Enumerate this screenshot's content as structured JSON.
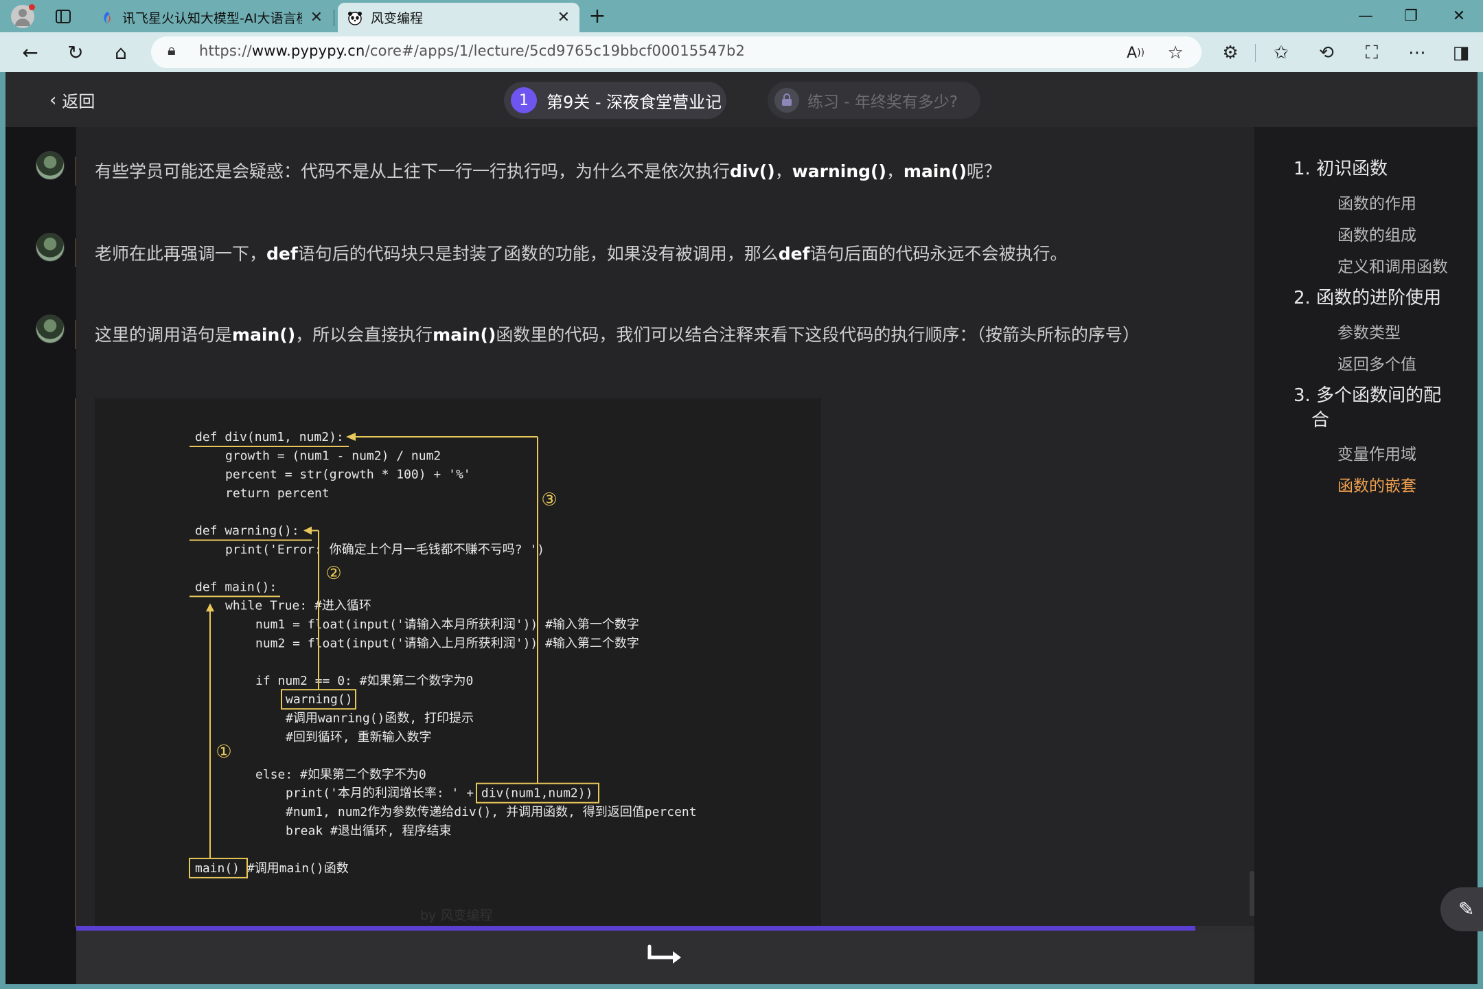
{
  "browser": {
    "tabs": [
      {
        "title": "讯飞星火认知大模型-AI大语言模",
        "active": false
      },
      {
        "title": "风变编程",
        "active": true
      }
    ],
    "url_prefix": "https://",
    "url_host": "www.pypypy.cn",
    "url_path": "/core#/apps/1/lecture/5cd9765c19bbcf00015547b2"
  },
  "header": {
    "back_label": "返回",
    "lesson_number": "1",
    "lesson_title": "第9关 - 深夜食堂营业记",
    "practice_title": "练习 - 年终奖有多少?"
  },
  "messages": [
    {
      "parts": [
        "有些学员可能还是会疑惑：代码不是从上往下一行一行执行吗，为什么不是依次执行",
        "div()",
        "，",
        "warning()",
        "，",
        "main()",
        "呢？"
      ]
    },
    {
      "parts": [
        "老师在此再强调一下，",
        "def",
        "语句后的代码块只是封装了函数的功能，如果没有被调用，那么",
        "def",
        "语句后面的代码永远不会被执行。"
      ]
    },
    {
      "parts": [
        "这里的调用语句是",
        "main()",
        "，所以会直接执行",
        "main()",
        "函数里的代码，我们可以结合注释来看下这段代码的执行顺序：（按箭头所标的序号）"
      ]
    }
  ],
  "code_image": {
    "lines": [
      "def div(num1, num2):",
      "    growth = (num1 - num2) / num2",
      "    percent = str(growth * 100) + '%'",
      "    return percent",
      "",
      "def warning():",
      "    print('Error: 你确定上个月一毛钱都不赚不亏吗? ')",
      "",
      "def main():",
      "    while True:   #进入循环",
      "        num1 = float(input('请输入本月所获利润')) #输入第一个数字",
      "        num2 = float(input('请输入上月所获利润')) #输入第二个数字",
      "",
      "        if num2 == 0:  #如果第二个数字为0",
      "            warning()",
      "            #调用wanring()函数, 打印提示",
      "            #回到循环, 重新输入数字",
      "",
      "        else: #如果第二个数字不为0",
      "            print('本月的利润增长率: ' + div(num1,num2))",
      "            #num1, num2作为参数传递给div(), 并调用函数, 得到返回值percent",
      "            break #退出循环, 程序结束",
      "",
      "main() #调用main()函数"
    ],
    "markers": [
      "①",
      "②",
      "③"
    ],
    "watermark": "by 风变编程",
    "accent_color": "#e8c85a"
  },
  "toc": [
    {
      "type": "h",
      "label": "1. 初识函数"
    },
    {
      "type": "i",
      "label": "函数的作用"
    },
    {
      "type": "i",
      "label": "函数的组成"
    },
    {
      "type": "i",
      "label": "定义和调用函数"
    },
    {
      "type": "h",
      "label": "2. 函数的进阶使用"
    },
    {
      "type": "i",
      "label": "参数类型"
    },
    {
      "type": "i",
      "label": "返回多个值"
    },
    {
      "type": "h",
      "label": "3. 多个函数间的配"
    },
    {
      "type": "h2",
      "label": "合"
    },
    {
      "type": "i",
      "label": "变量作用域"
    },
    {
      "type": "i",
      "label": "函数的嵌套",
      "active": true
    }
  ],
  "colors": {
    "accent_purple": "#6e55f0",
    "toc_active": "#f0a050"
  },
  "icons": {
    "next": "next-arrow-icon",
    "edit": "pencil-icon"
  }
}
